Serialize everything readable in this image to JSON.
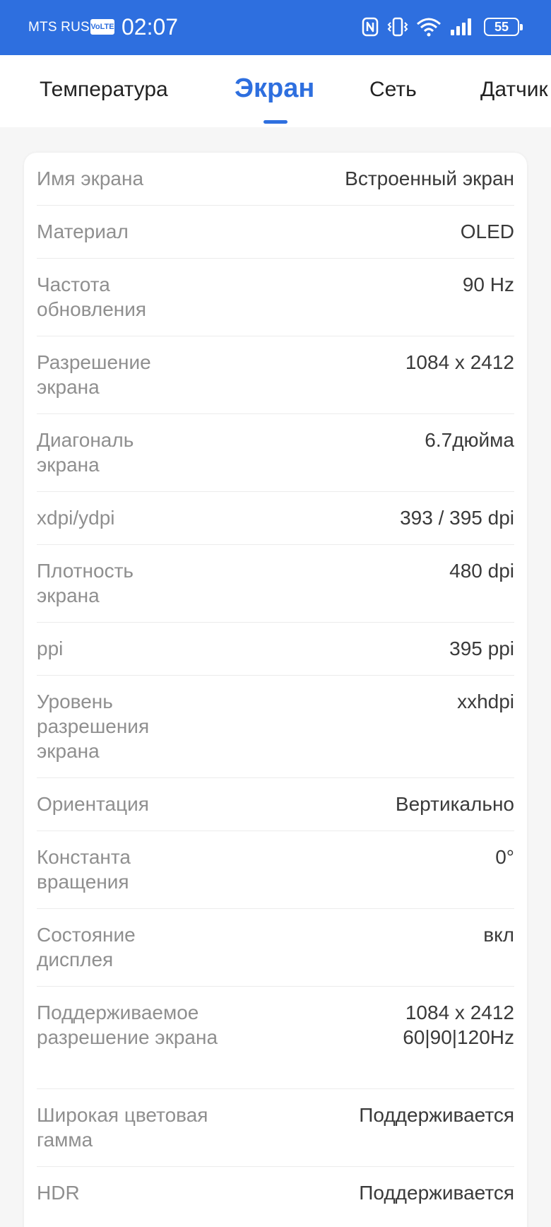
{
  "status_bar": {
    "carrier": "MTS RUS",
    "volte": "VoLTE",
    "time": "02:07",
    "battery": "55",
    "icons": [
      "nfc-icon",
      "vibrate-icon",
      "wifi-icon",
      "signal-icon",
      "battery-icon"
    ]
  },
  "tabs": [
    {
      "label": "Температура",
      "active": false
    },
    {
      "label": "Экран",
      "active": true
    },
    {
      "label": "Сеть",
      "active": false
    },
    {
      "label": "Датчик",
      "active": false
    }
  ],
  "rows": [
    {
      "label": "Имя экрана",
      "value": "Встроенный экран"
    },
    {
      "label": "Материал",
      "value": "OLED"
    },
    {
      "label": "Частота обновления",
      "value": "90 Hz"
    },
    {
      "label": "Разрешение экрана",
      "value": "1084 x 2412"
    },
    {
      "label": "Диагональ экрана",
      "value": "6.7дюйма"
    },
    {
      "label": "xdpi/ydpi",
      "value": "393 / 395 dpi"
    },
    {
      "label": "Плотность экрана",
      "value": "480 dpi"
    },
    {
      "label": "ppi",
      "value": "395 ppi"
    },
    {
      "label": "Уровень разрешения экрана",
      "value": "xxhdpi"
    },
    {
      "label": "Ориентация",
      "value": "Вертикально"
    },
    {
      "label": "Константа вращения",
      "value": "0°"
    },
    {
      "label": "Состояние дисплея",
      "value": "вкл"
    },
    {
      "label": "Поддерживаемое разрешение экрана",
      "value": "1084 x 2412\n60|90|120Hz"
    },
    {
      "label": "Широкая цветовая гамма",
      "value": "Поддерживается"
    },
    {
      "label": "HDR",
      "value": "Поддерживается"
    }
  ],
  "colors": {
    "accent": "#2e6fdf",
    "label": "#8f8f8f",
    "value": "#3a3a3a"
  }
}
